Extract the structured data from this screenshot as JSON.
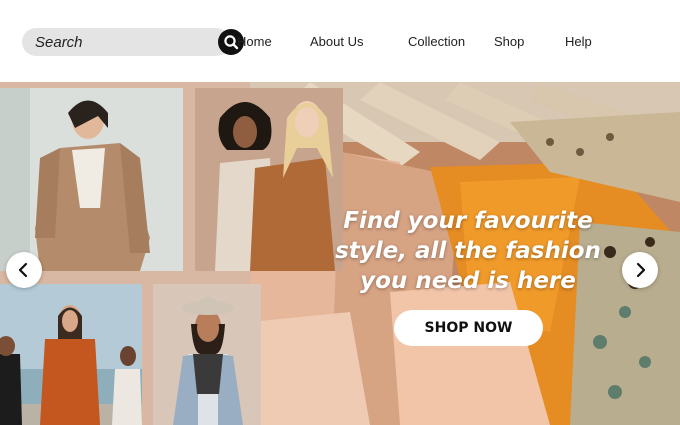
{
  "header": {
    "search": {
      "placeholder": "Search",
      "icon": "search-icon"
    },
    "nav": [
      "Home",
      "About Us",
      "Collection",
      "Shop",
      "Help"
    ]
  },
  "hero": {
    "headline": "Find your favourite style, all the fashion you need is here",
    "cta_label": "SHOP NOW",
    "prev_icon": "chevron-left-icon",
    "next_icon": "chevron-right-icon",
    "colors": {
      "backdrop": "#d9b8a3",
      "button": "#ffffff",
      "text": "#ffffff"
    }
  }
}
